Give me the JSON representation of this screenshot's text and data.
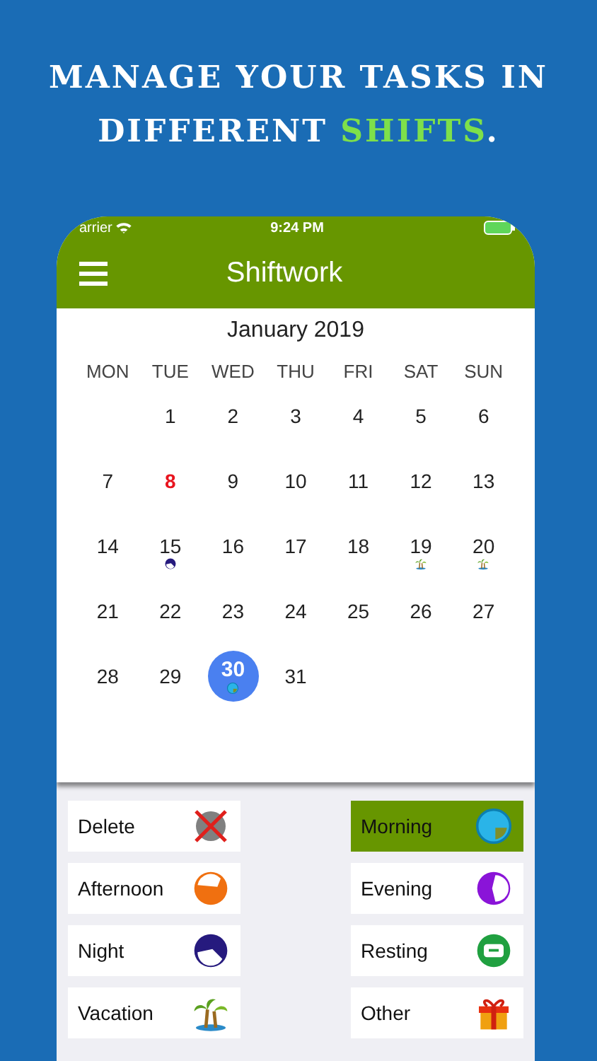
{
  "headline": {
    "lines": [
      {
        "parts": [
          {
            "text": "MANAGE YOUR TASKS IN",
            "highlight": false
          }
        ]
      },
      {
        "parts": [
          {
            "text": "DIFFERENT ",
            "highlight": false
          },
          {
            "text": "SHIFTS",
            "highlight": true
          },
          {
            "text": ".",
            "highlight": false
          }
        ]
      }
    ]
  },
  "status_bar": {
    "carrier": "arrier",
    "time": "9:24 PM"
  },
  "nav_bar": {
    "title": "Shiftwork"
  },
  "calendar": {
    "month": "January 2019",
    "weekdays": [
      "MON",
      "TUE",
      "WED",
      "THU",
      "FRI",
      "SAT",
      "SUN"
    ],
    "weeks": [
      {
        "kind": "first",
        "days": [
          {
            "day": "1",
            "today": false,
            "selected": false
          },
          {
            "day": "2",
            "today": false,
            "selected": false
          },
          {
            "day": "3",
            "today": false,
            "selected": false
          },
          {
            "day": "4",
            "today": false,
            "selected": false
          },
          {
            "day": "5",
            "today": false,
            "selected": false
          },
          {
            "day": "6",
            "today": false,
            "selected": false
          }
        ]
      },
      {
        "days": [
          {
            "day": "7",
            "today": false,
            "selected": false
          },
          {
            "day": "8",
            "today": true,
            "selected": false
          },
          {
            "day": "9",
            "today": false,
            "selected": false
          },
          {
            "day": "10",
            "today": false,
            "selected": false
          },
          {
            "day": "11",
            "today": false,
            "selected": false
          },
          {
            "day": "12",
            "today": false,
            "selected": false
          },
          {
            "day": "13",
            "today": false,
            "selected": false
          }
        ]
      },
      {
        "days": [
          {
            "day": "14",
            "today": false,
            "selected": false
          },
          {
            "day": "15",
            "today": false,
            "selected": false,
            "shift": {
              "kind": "night"
            }
          },
          {
            "day": "16",
            "today": false,
            "selected": false
          },
          {
            "day": "17",
            "today": false,
            "selected": false
          },
          {
            "day": "18",
            "today": false,
            "selected": false
          },
          {
            "day": "19",
            "today": false,
            "selected": false,
            "shift": {
              "kind": "vacation"
            }
          },
          {
            "day": "20",
            "today": false,
            "selected": false,
            "shift": {
              "kind": "vacation"
            }
          }
        ]
      },
      {
        "days": [
          {
            "day": "21",
            "today": false,
            "selected": false
          },
          {
            "day": "22",
            "today": false,
            "selected": false
          },
          {
            "day": "23",
            "today": false,
            "selected": false
          },
          {
            "day": "24",
            "today": false,
            "selected": false
          },
          {
            "day": "25",
            "today": false,
            "selected": false
          },
          {
            "day": "26",
            "today": false,
            "selected": false
          },
          {
            "day": "27",
            "today": false,
            "selected": false
          }
        ]
      },
      {
        "kind": "last",
        "days": [
          {
            "day": "28",
            "today": false,
            "selected": false
          },
          {
            "day": "29",
            "today": false,
            "selected": false
          },
          {
            "day": "30",
            "today": false,
            "selected": true,
            "shift": {
              "kind": "morning"
            }
          },
          {
            "day": "31",
            "today": false,
            "selected": false
          }
        ]
      }
    ]
  },
  "shifts": [
    {
      "label": "Delete",
      "kind": "delete",
      "selected": false
    },
    {
      "label": "Morning",
      "kind": "morning",
      "selected": true
    },
    {
      "label": "Afternoon",
      "kind": "afternoon",
      "selected": false
    },
    {
      "label": "Evening",
      "kind": "evening",
      "selected": false
    },
    {
      "label": "Night",
      "kind": "night",
      "selected": false
    },
    {
      "label": "Resting",
      "kind": "resting",
      "selected": false
    },
    {
      "label": "Vacation",
      "kind": "vacation",
      "selected": false
    },
    {
      "label": "Other",
      "kind": "other",
      "selected": false
    }
  ]
}
